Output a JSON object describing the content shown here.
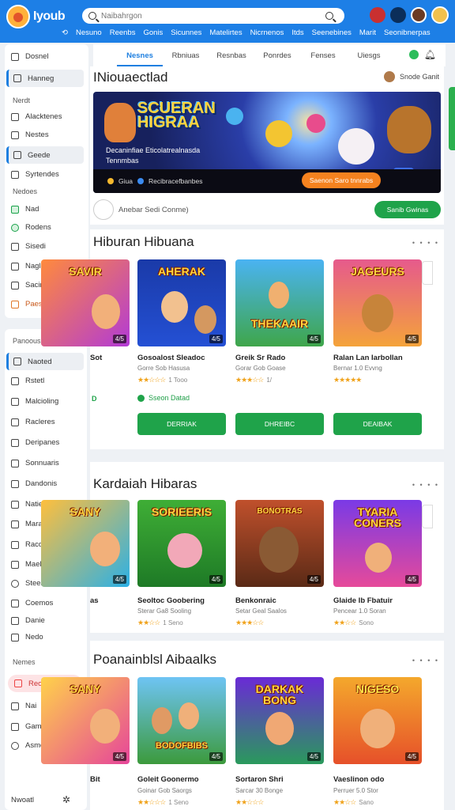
{
  "app": {
    "name": "Iyoub",
    "logo_icon": "mascot-logo-icon"
  },
  "search": {
    "placeholder": "Naibahrgon",
    "value": ""
  },
  "topnav": [
    "Nesuno",
    "Reenbs",
    "Gonis",
    "Sicunnes",
    "Matelirtes",
    "Nicrnenos",
    "Itds",
    "Seenebines",
    "Marit",
    "Seonibnerpas"
  ],
  "sidebar": {
    "group1": [
      {
        "label": "Dosnel",
        "icon": "person-icon"
      },
      {
        "label": "Hanneg",
        "icon": "search-icon",
        "active": true
      },
      {
        "label": "Nerdt",
        "type": "heading"
      },
      {
        "label": "Alacktenes",
        "icon": "document-icon"
      },
      {
        "label": "Nestes",
        "icon": "globe-icon"
      },
      {
        "label": "Geede",
        "icon": "folder-icon",
        "active": true
      },
      {
        "label": "Syrtendes",
        "icon": "grid-icon"
      },
      {
        "label": "Nedoes",
        "type": "heading"
      },
      {
        "label": "Nad",
        "icon": "image-icon",
        "color": "green"
      },
      {
        "label": "Rodens",
        "icon": "circle-icon",
        "color": "green"
      },
      {
        "label": "Sisedi",
        "icon": "doc-icon"
      },
      {
        "label": "Nagles",
        "icon": "page-icon"
      },
      {
        "label": "Sacinad",
        "icon": "edit-icon"
      },
      {
        "label": "Paeskeitres",
        "icon": "tag-icon",
        "color": "orange"
      }
    ],
    "group2": [
      {
        "label": "Panoous",
        "type": "heading"
      },
      {
        "label": "Naoted",
        "icon": "calendar-icon",
        "active": true
      },
      {
        "label": "Rstetl",
        "icon": "star-icon"
      },
      {
        "label": "Malcioling",
        "icon": "list-icon"
      },
      {
        "label": "Racleres",
        "icon": "box-icon"
      },
      {
        "label": "Deripanes",
        "icon": "window-icon"
      },
      {
        "label": "Sonnuaris",
        "icon": "layers-icon"
      },
      {
        "label": "Dandonis",
        "icon": "bookmark-icon"
      },
      {
        "label": "Natiernigans",
        "icon": "table-icon"
      },
      {
        "label": "Mara",
        "icon": "tag-icon"
      },
      {
        "label": "Racds",
        "icon": "screen-icon"
      },
      {
        "label": "Maelsntes",
        "icon": "alert-icon"
      },
      {
        "label": "Steeid",
        "icon": "clock-icon"
      },
      {
        "label": "Coemos",
        "icon": "chat-icon"
      },
      {
        "label": "Danie",
        "icon": "list-icon"
      },
      {
        "label": "Nedo",
        "icon": "stack-icon"
      },
      {
        "label": "Nemes",
        "type": "heading"
      },
      {
        "label": "Reoendenee",
        "icon": "flag-icon",
        "pill": true
      },
      {
        "label": "Nai",
        "icon": "home-icon"
      },
      {
        "label": "Gamrt",
        "icon": "box-icon"
      },
      {
        "label": "Asmos",
        "icon": "gear-icon"
      },
      {
        "label": "Nwoatl",
        "icon": "star-icon",
        "type": "footer"
      }
    ]
  },
  "tabs": [
    "Nesnes",
    "Rbniuas",
    "Resnbas",
    "Ponrdes",
    "Fenses",
    "Uiesgs"
  ],
  "page": {
    "title": "INiouaectlad",
    "user": "Snode Ganit"
  },
  "banner": {
    "title_line1": "SCUERAN",
    "title_line2": "HIGRAA",
    "subtitle": "Decaninfiae Eticolatrealnasda Tennmbas",
    "info1": "Giua",
    "info2": "Recibracefbanbes",
    "cta": "Saenon Saro tnnrabs"
  },
  "follow": {
    "text": "Anebar Sedi Conme)",
    "button": "Sanib Gwinas"
  },
  "sections": [
    {
      "title": "Hiburan Hibuana",
      "more": "• • • •",
      "games": [
        {
          "art": "SAVIR",
          "rating_badge": "4/5",
          "name": "Sot",
          "sub": "",
          "stars": "★★",
          "count": ""
        },
        {
          "art": "AHERAK",
          "rating_badge": "4/5",
          "name": "Gosoalost Sleadoc",
          "sub": "Gorre Sob Hasusa",
          "stars": "★★☆☆☆",
          "count": "1 Tooo"
        },
        {
          "art": "THEKAAIR",
          "rating_badge": "4/5",
          "name": "Greik Sr Rado",
          "sub": "Gorar Gob Goase",
          "stars": "★★★☆☆",
          "count": "1/"
        },
        {
          "art": "JAGEURS",
          "rating_badge": "4/5",
          "name": "Ralan Lan Iarbollan",
          "sub": "Bernar 1.0 Evvng",
          "stars": "★★★★★",
          "count": ""
        }
      ],
      "status": "Sseon Datad",
      "status_left": "D",
      "buttons": [
        "DERRIAK",
        "DHREIBC",
        "DEAIBAK"
      ]
    },
    {
      "title": "Kardaiah Hibaras",
      "more": "• • • •",
      "games": [
        {
          "art": "SANY",
          "rating_badge": "4/5",
          "name": "as",
          "sub": "",
          "stars": "",
          "count": ""
        },
        {
          "art": "SORIEERIS",
          "rating_badge": "4/5",
          "name": "Seoltoc Goobering",
          "sub": "Sterar Ga8 Sooling",
          "stars": "★★☆☆",
          "count": "1 Seno"
        },
        {
          "art": "BONOTRAS",
          "rating_badge": "4/5",
          "name": "Benkonraic",
          "sub": "Setar Geal Saalos",
          "stars": "★★★☆☆",
          "count": ""
        },
        {
          "art": "TYARIA CONERS",
          "rating_badge": "4/5",
          "name": "Glaide Ib Fbatuir",
          "sub": "Pencear 1.0 Soran",
          "stars": "★★☆☆",
          "count": "Sono"
        }
      ]
    },
    {
      "title": "Poanainblsl Aibaalks",
      "more": "• • • •",
      "games": [
        {
          "art": "SANY",
          "rating_badge": "4/5",
          "name": "Bit",
          "sub": "",
          "stars": "",
          "count": ""
        },
        {
          "art": "BODOFBIBS",
          "rating_badge": "4/5",
          "name": "Goleit Goonermo",
          "sub": "Goinar Gob Saorgs",
          "stars": "★★☆☆☆",
          "count": "1 Seno"
        },
        {
          "art": "DARKAK BONG",
          "rating_badge": "4/5",
          "name": "Sortaron Shri",
          "sub": "Sarcar 30 Bonge",
          "stars": "★★☆☆☆",
          "count": ""
        },
        {
          "art": "NIGESO",
          "rating_badge": "4/5",
          "name": "Vaeslinon odo",
          "sub": "Perruer 5.0 Stor",
          "stars": "★★☆☆",
          "count": "Sano"
        }
      ]
    }
  ],
  "colors": {
    "brand": "#1d7fe6",
    "primary_button": "#1fa34a",
    "cta": "#f5821f",
    "active_nav": "#1e7fe0"
  }
}
